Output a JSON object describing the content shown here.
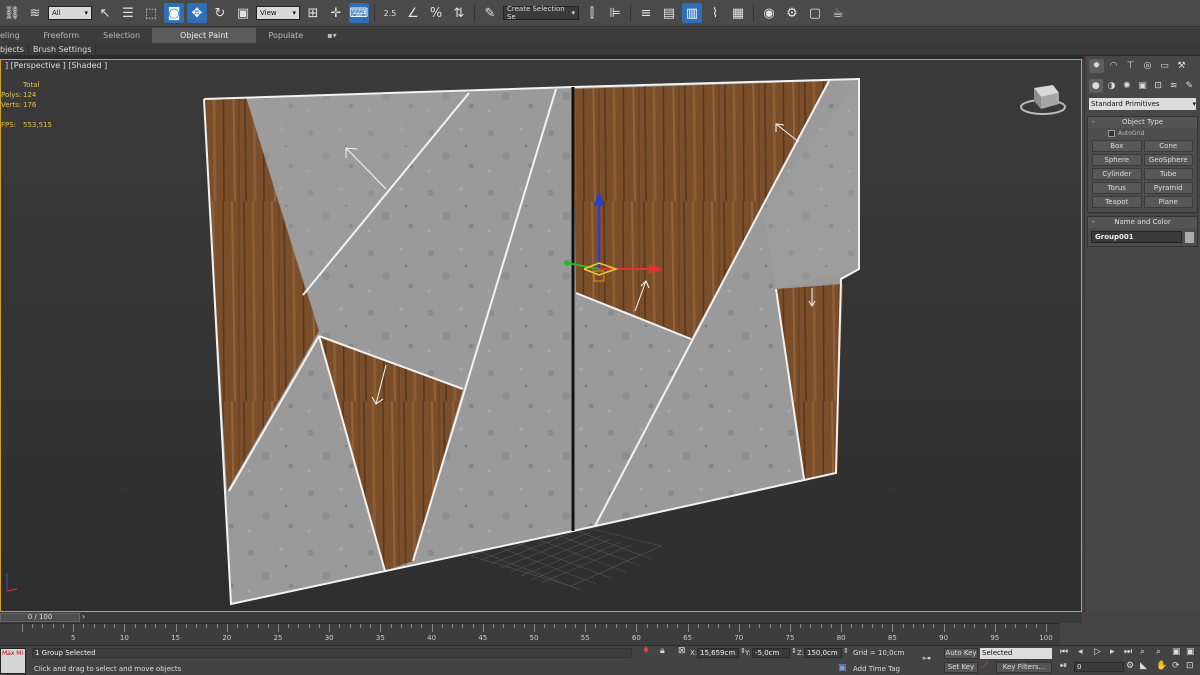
{
  "toolbar": {
    "filter_value": "All",
    "refcoord_value": "View",
    "snap_angle_label": "2.5",
    "selection_set_placeholder": "Create Selection Se",
    "icons": [
      "chain-link-icon",
      "unlink-icon",
      "bind-space-warp-icon",
      "selection-filter",
      "select-object-icon",
      "select-by-name-icon",
      "rect-region-icon",
      "window-crossing-icon",
      "select-move-icon",
      "select-rotate-icon",
      "select-scale-icon",
      "ref-coord-system",
      "pivot-icon",
      "select-manipulate-icon",
      "keyboard-shortcut-icon",
      "snaps-toggle-icon",
      "angle-snap-icon",
      "percent-snap-icon",
      "spinner-snap-icon",
      "edit-named-sel-icon",
      "mirror-icon",
      "align-icon",
      "toggle-scene-explorer-icon",
      "toggle-layer-explorer-icon",
      "toggle-ribbon-icon",
      "curve-editor-icon",
      "schematic-view-icon",
      "material-editor-icon",
      "render-setup-icon",
      "rendered-frame-window-icon",
      "render-production-icon",
      "render-teapot-icon"
    ]
  },
  "ribbon": {
    "tabs": [
      "eling",
      "Freeform",
      "Selection",
      "Object Paint",
      "Populate"
    ],
    "active_tab": "Object Paint",
    "row_items": [
      "bjects",
      "Brush Settings"
    ]
  },
  "viewport": {
    "label": "] [Perspective ] [Shaded ]",
    "stats": {
      "total_label": "Total",
      "polys_label": "Polys:",
      "polys_value": "124",
      "verts_label": "Verts:",
      "verts_value": "176",
      "fps_label": "FPS:",
      "fps_value": "553,515"
    }
  },
  "command_panel": {
    "category_dropdown": "Standard Primitives",
    "object_type_title": "Object Type",
    "autogrid_label": "AutoGrid",
    "primitives": [
      "Box",
      "Cone",
      "Sphere",
      "GeoSphere",
      "Cylinder",
      "Tube",
      "Torus",
      "Pyramid",
      "Teapot",
      "Plane"
    ],
    "name_color_title": "Name and Color",
    "object_name": "Group001"
  },
  "timeline": {
    "slider_label": "0 / 100",
    "ticks": [
      0,
      5,
      10,
      15,
      20,
      25,
      30,
      35,
      40,
      45,
      50,
      55,
      60,
      65,
      70,
      75,
      80,
      85,
      90,
      95,
      100
    ]
  },
  "status": {
    "selection_count": "1 Group Selected",
    "prompt": "Click and drag to select and move objects",
    "x_label": "X:",
    "x_value": "15,659cm",
    "y_label": "Y:",
    "y_value": "-5,0cm",
    "z_label": "Z:",
    "z_value": "150,0cm",
    "grid_label": "Grid = 10,0cm",
    "add_time_tag": "Add Time Tag",
    "auto_key": "Auto Key",
    "set_key": "Set Key",
    "selected_dropdown": "Selected",
    "key_filters": "Key Filters...",
    "frame_value": "0",
    "thumb_text": "Max Mi"
  }
}
